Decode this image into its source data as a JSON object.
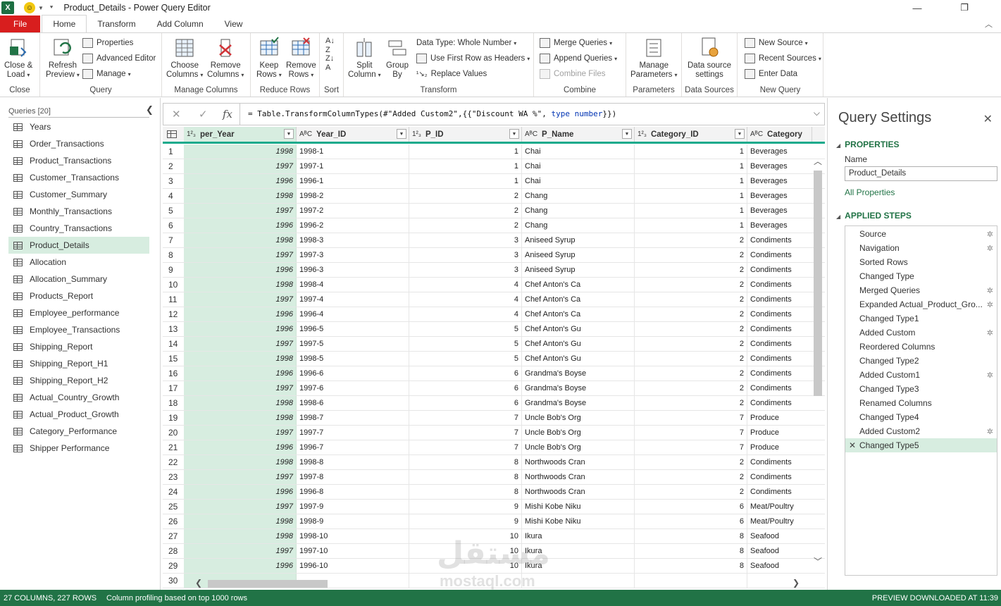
{
  "window": {
    "title": "Product_Details - Power Query Editor"
  },
  "tabs": [
    "File",
    "Home",
    "Transform",
    "Add Column",
    "View"
  ],
  "ribbon": {
    "close_group": {
      "label": "Close",
      "btn": "Close &",
      "btn2": "Load"
    },
    "query_group": {
      "label": "Query",
      "refresh": "Refresh",
      "refresh2": "Preview",
      "properties": "Properties",
      "advanced": "Advanced Editor",
      "manage": "Manage"
    },
    "columns_group": {
      "label": "Manage Columns",
      "choose": "Choose",
      "choose2": "Columns",
      "remove": "Remove",
      "remove2": "Columns"
    },
    "rows_group": {
      "label": "Reduce Rows",
      "keep": "Keep",
      "keep2": "Rows",
      "remove": "Remove",
      "remove2": "Rows"
    },
    "sort_group": {
      "label": "Sort"
    },
    "transform_group": {
      "label": "Transform",
      "split": "Split",
      "split2": "Column",
      "group": "Group",
      "group2": "By",
      "datatype": "Data Type: Whole Number",
      "firstrow": "Use First Row as Headers",
      "replace": "Replace Values"
    },
    "combine_group": {
      "label": "Combine",
      "merge": "Merge Queries",
      "append": "Append Queries",
      "files": "Combine Files"
    },
    "params_group": {
      "label": "Parameters",
      "manage": "Manage",
      "manage2": "Parameters"
    },
    "ds_group": {
      "label": "Data Sources",
      "ds": "Data source",
      "ds2": "settings"
    },
    "nq_group": {
      "label": "New Query",
      "new": "New Source",
      "recent": "Recent Sources",
      "enter": "Enter Data"
    }
  },
  "queries": {
    "header": "Queries [20]",
    "items": [
      "Years",
      "Order_Transactions",
      "Product_Transactions",
      "Customer_Transactions",
      "Customer_Summary",
      "Monthly_Transactions",
      "Country_Transactions",
      "Product_Details",
      "Allocation",
      "Allocation_Summary",
      "Products_Report",
      "Employee_performance",
      "Employee_Transactions",
      "Shipping_Report",
      "Shipping_Report_H1",
      "Shipping_Report_H2",
      "Actual_Country_Growth",
      "Actual_Product_Growth",
      "Category_Performance",
      "Shipper Performance"
    ],
    "selected": "Product_Details"
  },
  "formula": {
    "prefix": "= Table.TransformColumnTypes(#\"Added Custom2\",{{\"Discount WA %\", ",
    "kw1": "type",
    "kw2": " number",
    "suffix": "}})"
  },
  "grid": {
    "columns": [
      {
        "type": "1²₃",
        "name": "per_Year"
      },
      {
        "type": "AᴮC",
        "name": "Year_ID"
      },
      {
        "type": "1²₃",
        "name": "P_ID"
      },
      {
        "type": "AᴮC",
        "name": "P_Name"
      },
      {
        "type": "1²₃",
        "name": "Category_ID"
      },
      {
        "type": "AᴮC",
        "name": "Category"
      }
    ],
    "rows": [
      [
        "1",
        "1998",
        "1998-1",
        "1",
        "Chai",
        "1",
        "Beverages"
      ],
      [
        "2",
        "1997",
        "1997-1",
        "1",
        "Chai",
        "1",
        "Beverages"
      ],
      [
        "3",
        "1996",
        "1996-1",
        "1",
        "Chai",
        "1",
        "Beverages"
      ],
      [
        "4",
        "1998",
        "1998-2",
        "2",
        "Chang",
        "1",
        "Beverages"
      ],
      [
        "5",
        "1997",
        "1997-2",
        "2",
        "Chang",
        "1",
        "Beverages"
      ],
      [
        "6",
        "1996",
        "1996-2",
        "2",
        "Chang",
        "1",
        "Beverages"
      ],
      [
        "7",
        "1998",
        "1998-3",
        "3",
        "Aniseed Syrup",
        "2",
        "Condiments"
      ],
      [
        "8",
        "1997",
        "1997-3",
        "3",
        "Aniseed Syrup",
        "2",
        "Condiments"
      ],
      [
        "9",
        "1996",
        "1996-3",
        "3",
        "Aniseed Syrup",
        "2",
        "Condiments"
      ],
      [
        "10",
        "1998",
        "1998-4",
        "4",
        "Chef Anton's Ca",
        "2",
        "Condiments"
      ],
      [
        "11",
        "1997",
        "1997-4",
        "4",
        "Chef Anton's Ca",
        "2",
        "Condiments"
      ],
      [
        "12",
        "1996",
        "1996-4",
        "4",
        "Chef Anton's Ca",
        "2",
        "Condiments"
      ],
      [
        "13",
        "1996",
        "1996-5",
        "5",
        "Chef Anton's Gu",
        "2",
        "Condiments"
      ],
      [
        "14",
        "1997",
        "1997-5",
        "5",
        "Chef Anton's Gu",
        "2",
        "Condiments"
      ],
      [
        "15",
        "1998",
        "1998-5",
        "5",
        "Chef Anton's Gu",
        "2",
        "Condiments"
      ],
      [
        "16",
        "1996",
        "1996-6",
        "6",
        "Grandma's Boyse",
        "2",
        "Condiments"
      ],
      [
        "17",
        "1997",
        "1997-6",
        "6",
        "Grandma's Boyse",
        "2",
        "Condiments"
      ],
      [
        "18",
        "1998",
        "1998-6",
        "6",
        "Grandma's Boyse",
        "2",
        "Condiments"
      ],
      [
        "19",
        "1998",
        "1998-7",
        "7",
        "Uncle Bob's Org",
        "7",
        "Produce"
      ],
      [
        "20",
        "1997",
        "1997-7",
        "7",
        "Uncle Bob's Org",
        "7",
        "Produce"
      ],
      [
        "21",
        "1996",
        "1996-7",
        "7",
        "Uncle Bob's Org",
        "7",
        "Produce"
      ],
      [
        "22",
        "1998",
        "1998-8",
        "8",
        "Northwoods Cran",
        "2",
        "Condiments"
      ],
      [
        "23",
        "1997",
        "1997-8",
        "8",
        "Northwoods Cran",
        "2",
        "Condiments"
      ],
      [
        "24",
        "1996",
        "1996-8",
        "8",
        "Northwoods Cran",
        "2",
        "Condiments"
      ],
      [
        "25",
        "1997",
        "1997-9",
        "9",
        "Mishi Kobe Niku",
        "6",
        "Meat/Poultry"
      ],
      [
        "26",
        "1998",
        "1998-9",
        "9",
        "Mishi Kobe Niku",
        "6",
        "Meat/Poultry"
      ],
      [
        "27",
        "1998",
        "1998-10",
        "10",
        "Ikura",
        "8",
        "Seafood"
      ],
      [
        "28",
        "1997",
        "1997-10",
        "10",
        "Ikura",
        "8",
        "Seafood"
      ],
      [
        "29",
        "1996",
        "1996-10",
        "10",
        "Ikura",
        "8",
        "Seafood"
      ],
      [
        "30",
        "",
        "",
        "",
        "",
        "",
        ""
      ]
    ]
  },
  "settings": {
    "title": "Query Settings",
    "properties": "PROPERTIES",
    "name_label": "Name",
    "name_value": "Product_Details",
    "all_props": "All Properties",
    "applied": "APPLIED STEPS",
    "steps": [
      {
        "n": "Source",
        "g": true
      },
      {
        "n": "Navigation",
        "g": true
      },
      {
        "n": "Sorted Rows",
        "g": false
      },
      {
        "n": "Changed Type",
        "g": false
      },
      {
        "n": "Merged Queries",
        "g": true
      },
      {
        "n": "Expanded Actual_Product_Gro...",
        "g": true
      },
      {
        "n": "Changed Type1",
        "g": false
      },
      {
        "n": "Added Custom",
        "g": true
      },
      {
        "n": "Reordered Columns",
        "g": false
      },
      {
        "n": "Changed Type2",
        "g": false
      },
      {
        "n": "Added Custom1",
        "g": true
      },
      {
        "n": "Changed Type3",
        "g": false
      },
      {
        "n": "Renamed Columns",
        "g": false
      },
      {
        "n": "Changed Type4",
        "g": false
      },
      {
        "n": "Added Custom2",
        "g": true
      },
      {
        "n": "Changed Type5",
        "g": false
      }
    ],
    "selected_step": "Changed Type5"
  },
  "status": {
    "left": "27 COLUMNS, 227 ROWS",
    "profiling": "Column profiling based on top 1000 rows",
    "right": "PREVIEW DOWNLOADED AT 11:39"
  },
  "watermark": {
    "line1": "مستقل",
    "line2": "mostaql.com"
  },
  "colors": {
    "accent": "#217346",
    "file": "#d81e1e",
    "selection": "#d7ede0",
    "header_bar": "#1aaa8c"
  }
}
